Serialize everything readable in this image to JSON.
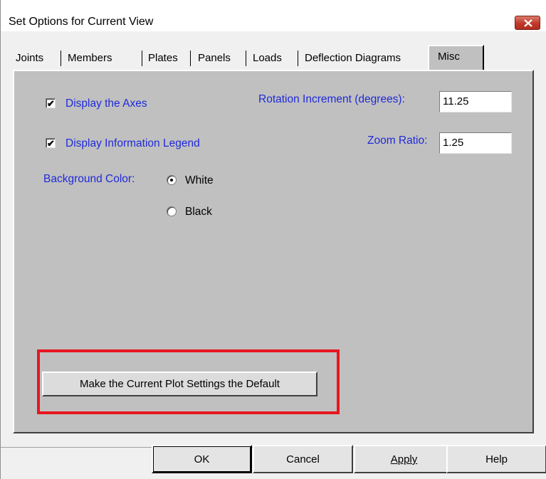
{
  "window": {
    "title": "Set Options for Current View",
    "close_icon": "close-icon"
  },
  "tabs": [
    {
      "label": "Joints"
    },
    {
      "label": "Members"
    },
    {
      "label": "Plates"
    },
    {
      "label": "Panels"
    },
    {
      "label": "Loads"
    },
    {
      "label": "Deflection Diagrams"
    },
    {
      "label": "Misc",
      "active": true
    }
  ],
  "misc": {
    "display_axes": {
      "label": "Display the Axes",
      "checked": true
    },
    "display_legend": {
      "label": "Display Information Legend",
      "checked": true
    },
    "background_color": {
      "label": "Background Color:",
      "options": [
        {
          "label": "White",
          "selected": true
        },
        {
          "label": "Black",
          "selected": false
        }
      ]
    },
    "rotation_increment": {
      "label": "Rotation Increment (degrees):",
      "value": "11.25"
    },
    "zoom_ratio": {
      "label": "Zoom Ratio:",
      "value": "1.25"
    },
    "make_default_label": "Make the Current Plot Settings the Default"
  },
  "buttons": {
    "ok": "OK",
    "cancel": "Cancel",
    "apply": "Apply",
    "help": "Help"
  },
  "colors": {
    "label_blue": "#1f2ad9",
    "highlight_red": "#e8161f",
    "panel_gray": "#c0c0c0"
  }
}
